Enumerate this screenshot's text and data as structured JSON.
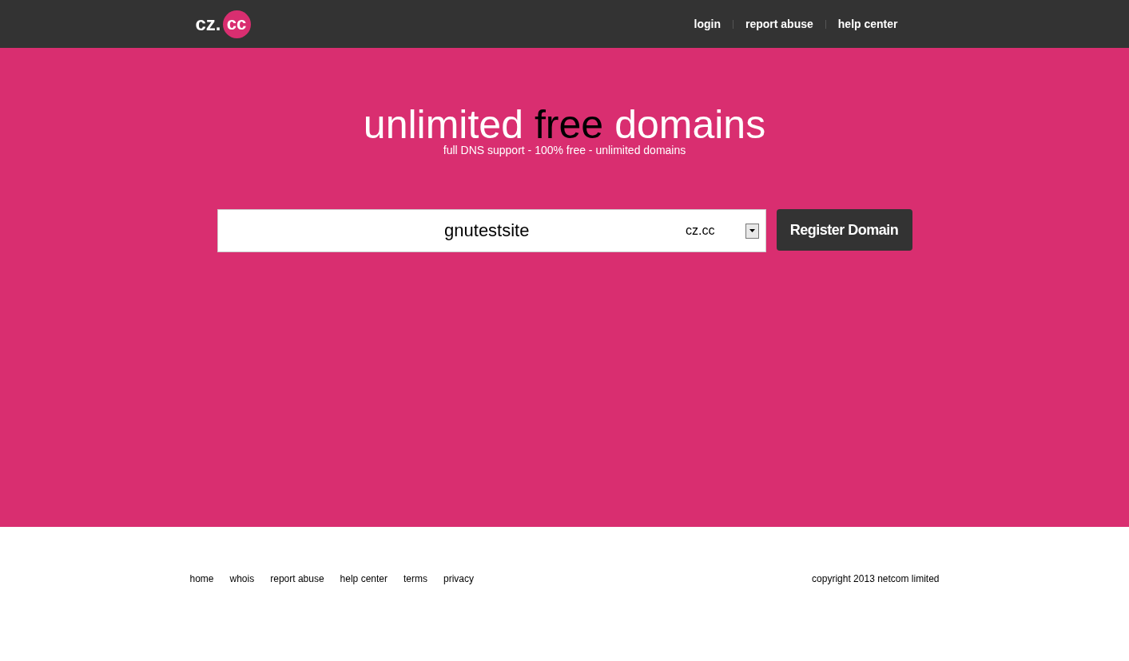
{
  "logo": {
    "prefix": "cz.",
    "badge": "cc"
  },
  "nav": [
    "login",
    "report abuse",
    "help center"
  ],
  "headline": [
    {
      "text": "unlimited",
      "highlighted": false
    },
    {
      "text": "free",
      "highlighted": true
    },
    {
      "text": "domains",
      "highlighted": false
    }
  ],
  "tagline": "full DNS support - 100% free - unlimited domains",
  "search": {
    "value": "gnutestsite",
    "zone": "cz.cc",
    "button": "Register Domain"
  },
  "footer": {
    "links": [
      "home",
      "whois",
      "report abuse",
      "help center",
      "terms",
      "privacy"
    ],
    "copyright": "copyright 2013 netcom limited"
  }
}
